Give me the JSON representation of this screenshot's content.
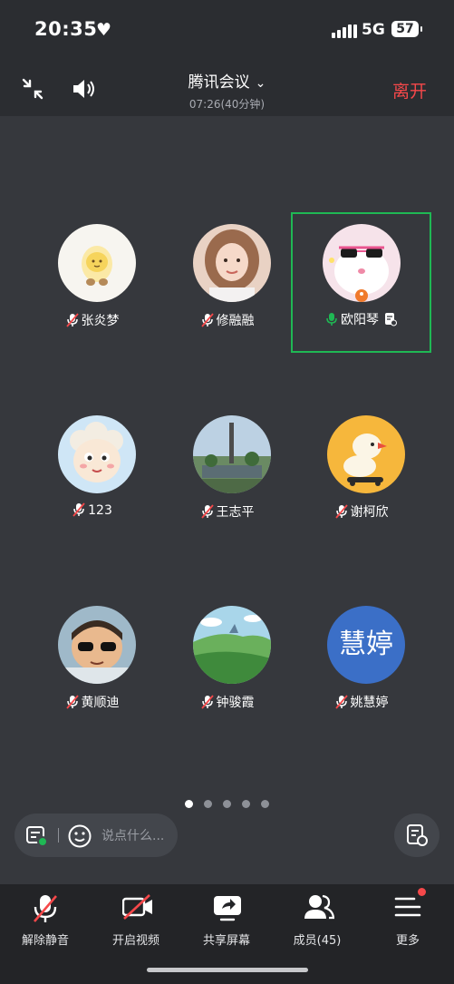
{
  "status": {
    "time": "20:35",
    "network": "5G",
    "battery": "57"
  },
  "header": {
    "title": "腾讯会议",
    "subtitle": "07:26(40分钟)",
    "leave_label": "离开"
  },
  "participants": [
    {
      "name": "张炎梦",
      "mic": "muted"
    },
    {
      "name": "修融融",
      "mic": "muted"
    },
    {
      "name": "欧阳琴",
      "mic": "speaking",
      "active": true
    },
    {
      "name": "123",
      "mic": "muted"
    },
    {
      "name": "王志平",
      "mic": "muted"
    },
    {
      "name": "谢柯欣",
      "mic": "muted"
    },
    {
      "name": "黄顺迪",
      "mic": "muted"
    },
    {
      "name": "钟骏霞",
      "mic": "muted"
    },
    {
      "name": "姚慧婷",
      "mic": "muted",
      "avatar_text": "慧婷"
    }
  ],
  "pager": {
    "pages": 5,
    "current": 1
  },
  "chat": {
    "placeholder": "说点什么..."
  },
  "toolbar": {
    "unmute": "解除静音",
    "video": "开启视频",
    "share": "共享屏幕",
    "members": "成员(45)",
    "more": "更多"
  },
  "colors": {
    "accent_green": "#1fb854",
    "leave_red": "#f5484a",
    "background": "#36383d"
  }
}
